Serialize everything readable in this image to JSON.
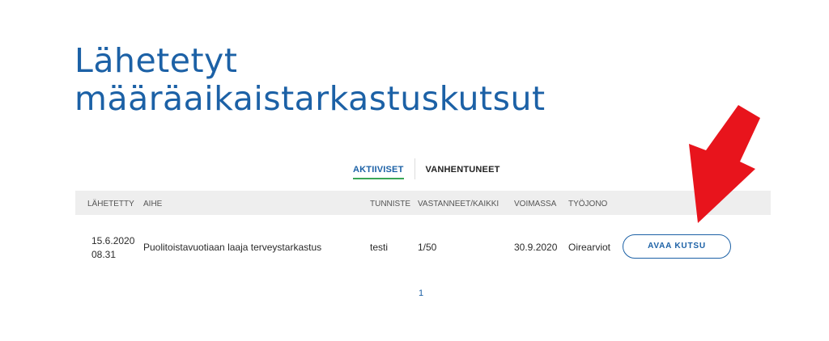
{
  "page": {
    "title_line1": "Lähetetyt",
    "title_line2": "määräaikaistarkastuskutsut"
  },
  "tabs": [
    {
      "label": "AKTIIVISET",
      "active": true
    },
    {
      "label": "VANHENTUNEET",
      "active": false
    }
  ],
  "table": {
    "headers": {
      "sent": "LÄHETETTY",
      "subject": "AIHE",
      "identifier": "TUNNISTE",
      "responded": "VASTANNEET/KAIKKI",
      "valid": "VOIMASSA",
      "queue": "TYÖJONO"
    },
    "rows": [
      {
        "sent_date": "15.6.2020",
        "sent_time": "08.31",
        "subject": "Puolitoistavuotiaan laaja terveystarkastus",
        "identifier": "testi",
        "responded": "1/50",
        "valid": "30.9.2020",
        "queue": "Oirearviot",
        "action_label": "AVAA KUTSU"
      }
    ]
  },
  "pagination": {
    "current": "1"
  },
  "colors": {
    "brand": "#1c61a6",
    "tab_underline": "#3aa657",
    "arrow": "#e8141c"
  },
  "icons": {
    "annotation": "red-arrow-icon"
  }
}
